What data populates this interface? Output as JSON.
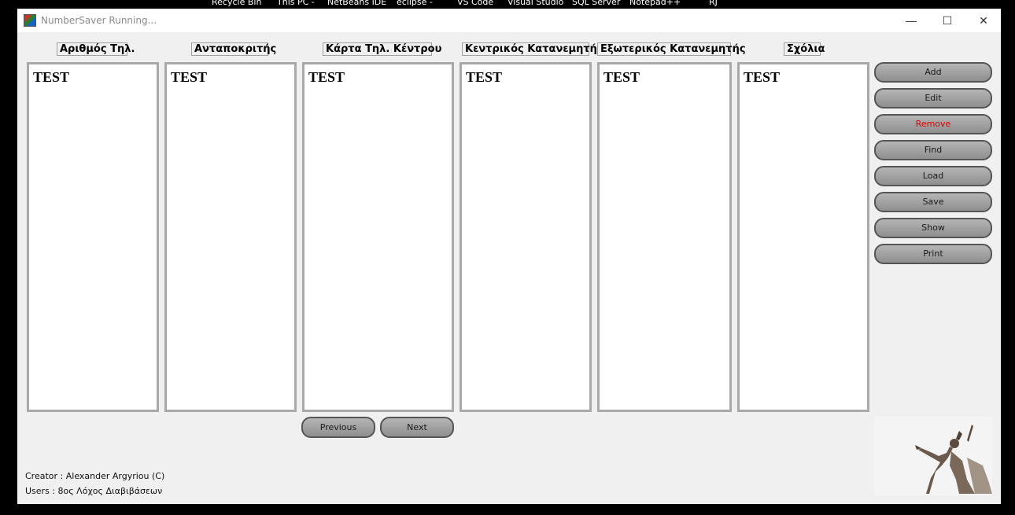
{
  "desktop": {
    "labels": [
      "Recycle Bin",
      "This PC -",
      "NetBeans IDE",
      "eclipse -",
      "VS Code",
      "Visual Studio",
      "SQL Server",
      "Notepad++",
      "RJ"
    ]
  },
  "window": {
    "title": "NumberSaver Running...",
    "controls": {
      "minimize": "—",
      "maximize": "☐",
      "close": "✕"
    }
  },
  "columns": [
    {
      "header": "Αριθμός Τηλ.",
      "value": "TEST"
    },
    {
      "header": "Ανταποκριτής",
      "value": "TEST"
    },
    {
      "header": "Κάρτα Τηλ. Κέντρου",
      "value": "TEST"
    },
    {
      "header": "Κεντρικός Κατανεμητής",
      "value": "TEST"
    },
    {
      "header": "Εξωτερικός Κατανεμητής",
      "value": "TEST"
    },
    {
      "header": "Σχόλια",
      "value": "TEST"
    }
  ],
  "actions": {
    "add": "Add",
    "edit": "Edit",
    "remove": "Remove",
    "find": "Find",
    "load": "Load",
    "save": "Save",
    "show": "Show",
    "print": "Print"
  },
  "navigation": {
    "previous": "Previous",
    "next": "Next"
  },
  "footer": {
    "creator": "Creator : Alexander Argyriou (C)",
    "users": "Users : 8ος Λόχος Διαβιβάσεων"
  },
  "colors": {
    "remove_text": "#e00000",
    "button_border": "#555555",
    "panel_border": "#a9a9a9"
  }
}
